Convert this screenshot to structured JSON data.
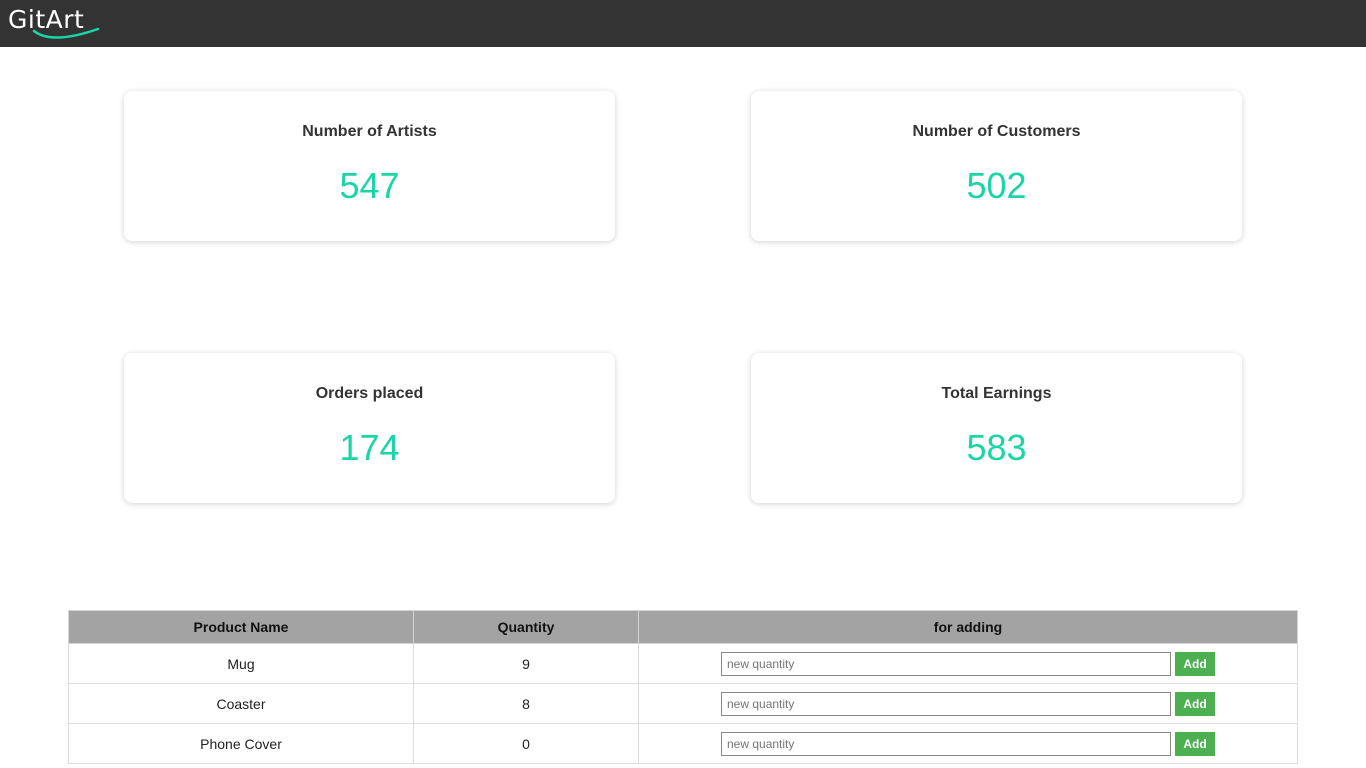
{
  "header": {
    "logo_text": "GitArt"
  },
  "stats": {
    "artists": {
      "label": "Number of Artists",
      "value": "547"
    },
    "customers": {
      "label": "Number of Customers",
      "value": "502"
    },
    "orders": {
      "label": "Orders placed",
      "value": "174"
    },
    "earnings": {
      "label": "Total Earnings",
      "value": "583"
    }
  },
  "table": {
    "headers": [
      "Product Name",
      "Quantity",
      "for adding"
    ],
    "rows": [
      {
        "name": "Mug",
        "quantity": "9"
      },
      {
        "name": "Coaster",
        "quantity": "8"
      },
      {
        "name": "Phone Cover",
        "quantity": "0"
      }
    ],
    "input_placeholder": "new quantity",
    "button_label": "Add"
  },
  "colors": {
    "topbar": "#333333",
    "stat_value": "#1ad6a6",
    "table_header": "#a3a3a3",
    "add_button": "#4caf50"
  }
}
